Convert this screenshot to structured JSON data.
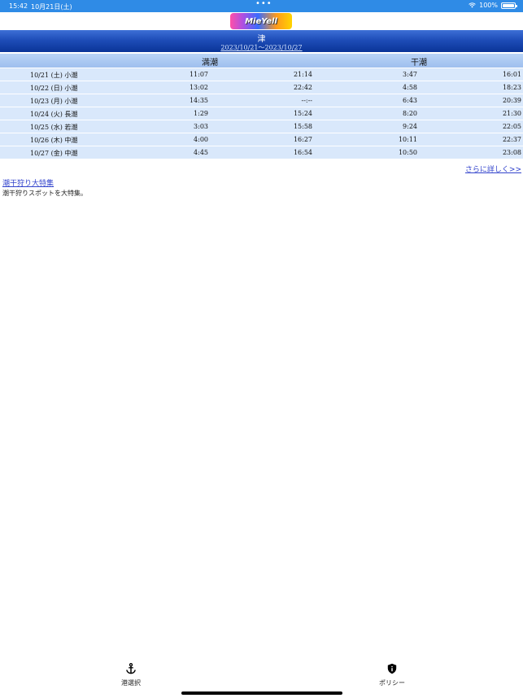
{
  "status_bar": {
    "time": "15:42",
    "date": "10月21日(土)",
    "battery": "100%"
  },
  "logo": {
    "text": "MieYell"
  },
  "port": {
    "name": "津",
    "range": "2023/10/21〜2023/10/27"
  },
  "table": {
    "headers": {
      "high": "満潮",
      "low": "干潮"
    },
    "rows": [
      {
        "date": "10/21 (土) 小潮",
        "high1": "11:07",
        "high2": "21:14",
        "low1": "3:47",
        "low2": "16:01"
      },
      {
        "date": "10/22 (日) 小潮",
        "high1": "13:02",
        "high2": "22:42",
        "low1": "4:58",
        "low2": "18:23"
      },
      {
        "date": "10/23 (月) 小潮",
        "high1": "14:35",
        "high2": "--:--",
        "low1": "6:43",
        "low2": "20:39"
      },
      {
        "date": "10/24 (火) 長潮",
        "high1": "1:29",
        "high2": "15:24",
        "low1": "8:20",
        "low2": "21:30"
      },
      {
        "date": "10/25 (水) 若潮",
        "high1": "3:03",
        "high2": "15:58",
        "low1": "9:24",
        "low2": "22:05"
      },
      {
        "date": "10/26 (木) 中潮",
        "high1": "4:00",
        "high2": "16:27",
        "low1": "10:11",
        "low2": "22:37"
      },
      {
        "date": "10/27 (金) 中潮",
        "high1": "4:45",
        "high2": "16:54",
        "low1": "10:50",
        "low2": "23:08"
      }
    ]
  },
  "more_link": "さらに詳しく>>",
  "feature": {
    "link": "潮干狩り大特集",
    "description": "潮干狩りスポットを大特集。"
  },
  "tabs": [
    {
      "label": "港選択",
      "icon": "anchor-icon"
    },
    {
      "label": "ポリシー",
      "icon": "shield-icon"
    }
  ]
}
